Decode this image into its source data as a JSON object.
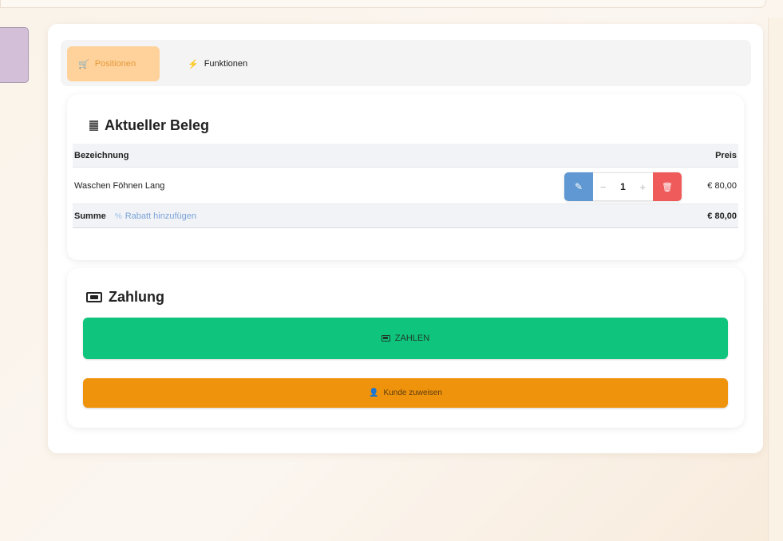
{
  "tabs": [
    {
      "label": "Positionen",
      "icon": "cart-icon",
      "active": true
    },
    {
      "label": "Funktionen",
      "icon": "lightning-icon",
      "active": false
    }
  ],
  "beleg": {
    "title": "Aktueller Beleg",
    "columns": {
      "name": "Bezeichnung",
      "price": "Preis"
    },
    "items": [
      {
        "name": "Waschen Föhnen Lang",
        "quantity": "1",
        "price": "€ 80,00"
      }
    ],
    "sum_label": "Summe",
    "rabatt_label": "Rabatt hinzufügen",
    "sum_value": "€ 80,00"
  },
  "zahlung": {
    "title": "Zahlung",
    "pay_button": "ZAHLEN",
    "customer_button": "Kunde zuweisen"
  },
  "colors": {
    "active_tab_bg": "#ffd29c",
    "pay_green": "#0fc47c",
    "customer_orange": "#f0930c",
    "edit_blue": "#5f98d2",
    "delete_red": "#ef5b5b"
  }
}
